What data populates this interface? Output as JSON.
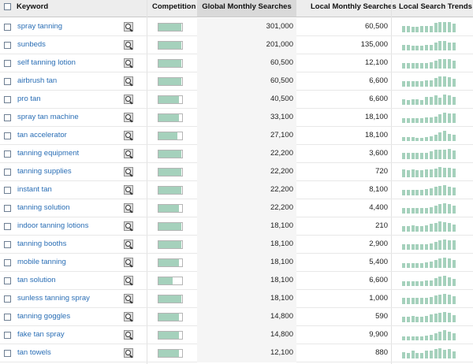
{
  "header": {
    "keyword": "Keyword",
    "competition": "Competition",
    "global": "Global Monthly Searches",
    "local": "Local Monthly Searches",
    "trends": "Local Search Trends"
  },
  "colors": {
    "link": "#2a6eb5",
    "bar": "#a5d1bc",
    "header_bg": "#ededed"
  },
  "rows": [
    {
      "keyword": "spray tanning",
      "global": "301,000",
      "local": "60,500",
      "competition": 0.98,
      "trend": [
        0.6,
        0.6,
        0.55,
        0.55,
        0.6,
        0.65,
        0.65,
        0.9,
        1,
        1,
        1,
        0.85
      ]
    },
    {
      "keyword": "sunbeds",
      "global": "201,000",
      "local": "135,000",
      "competition": 0.98,
      "trend": [
        0.5,
        0.5,
        0.45,
        0.45,
        0.45,
        0.5,
        0.5,
        0.75,
        0.9,
        0.9,
        0.8,
        0.8
      ]
    },
    {
      "keyword": "self tanning lotion",
      "global": "60,500",
      "local": "12,100",
      "competition": 0.98,
      "trend": [
        0.5,
        0.5,
        0.5,
        0.5,
        0.5,
        0.55,
        0.6,
        0.8,
        0.9,
        0.95,
        0.9,
        0.75
      ]
    },
    {
      "keyword": "airbrush tan",
      "global": "60,500",
      "local": "6,600",
      "competition": 0.98,
      "trend": [
        0.55,
        0.55,
        0.55,
        0.55,
        0.55,
        0.6,
        0.65,
        0.85,
        1,
        1,
        0.9,
        0.75
      ]
    },
    {
      "keyword": "pro tan",
      "global": "40,500",
      "local": "6,600",
      "competition": 0.85,
      "trend": [
        0.55,
        0.45,
        0.55,
        0.5,
        0.45,
        0.75,
        0.75,
        0.95,
        0.7,
        1,
        0.9,
        0.75
      ]
    },
    {
      "keyword": "spray tan machine",
      "global": "33,100",
      "local": "18,100",
      "competition": 0.85,
      "trend": [
        0.45,
        0.45,
        0.45,
        0.45,
        0.45,
        0.5,
        0.5,
        0.65,
        0.85,
        1,
        0.9,
        0.9
      ]
    },
    {
      "keyword": "tan accelerator",
      "global": "27,100",
      "local": "18,100",
      "competition": 0.8,
      "trend": [
        0.35,
        0.35,
        0.35,
        0.3,
        0.3,
        0.35,
        0.45,
        0.6,
        0.85,
        1,
        0.7,
        0.65
      ]
    },
    {
      "keyword": "tanning equipment",
      "global": "22,200",
      "local": "3,600",
      "competition": 0.98,
      "trend": [
        0.6,
        0.65,
        0.6,
        0.6,
        0.6,
        0.65,
        0.75,
        0.9,
        0.9,
        0.95,
        1,
        0.85
      ]
    },
    {
      "keyword": "tanning supplies",
      "global": "22,200",
      "local": "720",
      "competition": 0.98,
      "trend": [
        0.75,
        0.7,
        0.75,
        0.7,
        0.7,
        0.75,
        0.8,
        0.85,
        1,
        0.95,
        0.9,
        0.85
      ]
    },
    {
      "keyword": "instant tan",
      "global": "22,200",
      "local": "8,100",
      "competition": 0.98,
      "trend": [
        0.55,
        0.55,
        0.55,
        0.55,
        0.55,
        0.6,
        0.7,
        0.85,
        0.95,
        1,
        0.85,
        0.75
      ]
    },
    {
      "keyword": "tanning solution",
      "global": "22,200",
      "local": "4,400",
      "competition": 0.85,
      "trend": [
        0.5,
        0.5,
        0.5,
        0.5,
        0.5,
        0.55,
        0.6,
        0.8,
        0.9,
        1,
        0.95,
        0.8
      ]
    },
    {
      "keyword": "indoor tanning lotions",
      "global": "18,100",
      "local": "210",
      "competition": 0.98,
      "trend": [
        0.55,
        0.55,
        0.6,
        0.55,
        0.55,
        0.6,
        0.75,
        0.85,
        1,
        0.95,
        0.85,
        0.7
      ]
    },
    {
      "keyword": "tanning booths",
      "global": "18,100",
      "local": "2,900",
      "competition": 0.98,
      "trend": [
        0.55,
        0.5,
        0.55,
        0.55,
        0.55,
        0.55,
        0.65,
        0.8,
        0.95,
        1,
        0.95,
        0.9
      ]
    },
    {
      "keyword": "mobile tanning",
      "global": "18,100",
      "local": "5,400",
      "competition": 0.85,
      "trend": [
        0.45,
        0.45,
        0.45,
        0.45,
        0.45,
        0.5,
        0.6,
        0.8,
        0.95,
        1,
        0.9,
        0.75
      ]
    },
    {
      "keyword": "tan solution",
      "global": "18,100",
      "local": "6,600",
      "competition": 0.6,
      "trend": [
        0.45,
        0.45,
        0.45,
        0.45,
        0.45,
        0.5,
        0.55,
        0.8,
        0.9,
        1,
        0.85,
        0.7
      ]
    },
    {
      "keyword": "sunless tanning spray",
      "global": "18,100",
      "local": "1,000",
      "competition": 0.98,
      "trend": [
        0.6,
        0.6,
        0.6,
        0.6,
        0.6,
        0.65,
        0.7,
        0.85,
        0.95,
        1,
        0.9,
        0.75
      ]
    },
    {
      "keyword": "tanning goggles",
      "global": "14,800",
      "local": "590",
      "competition": 0.85,
      "trend": [
        0.55,
        0.55,
        0.6,
        0.55,
        0.55,
        0.65,
        0.75,
        0.85,
        0.95,
        1,
        0.95,
        0.7
      ]
    },
    {
      "keyword": "fake tan spray",
      "global": "14,800",
      "local": "9,900",
      "competition": 0.85,
      "trend": [
        0.4,
        0.4,
        0.4,
        0.4,
        0.4,
        0.45,
        0.5,
        0.7,
        0.85,
        1,
        0.85,
        0.7
      ]
    },
    {
      "keyword": "tan towels",
      "global": "12,100",
      "local": "880",
      "competition": 0.85,
      "trend": [
        0.6,
        0.55,
        0.75,
        0.55,
        0.55,
        0.8,
        0.75,
        0.9,
        1,
        0.85,
        0.9,
        0.7
      ]
    }
  ]
}
